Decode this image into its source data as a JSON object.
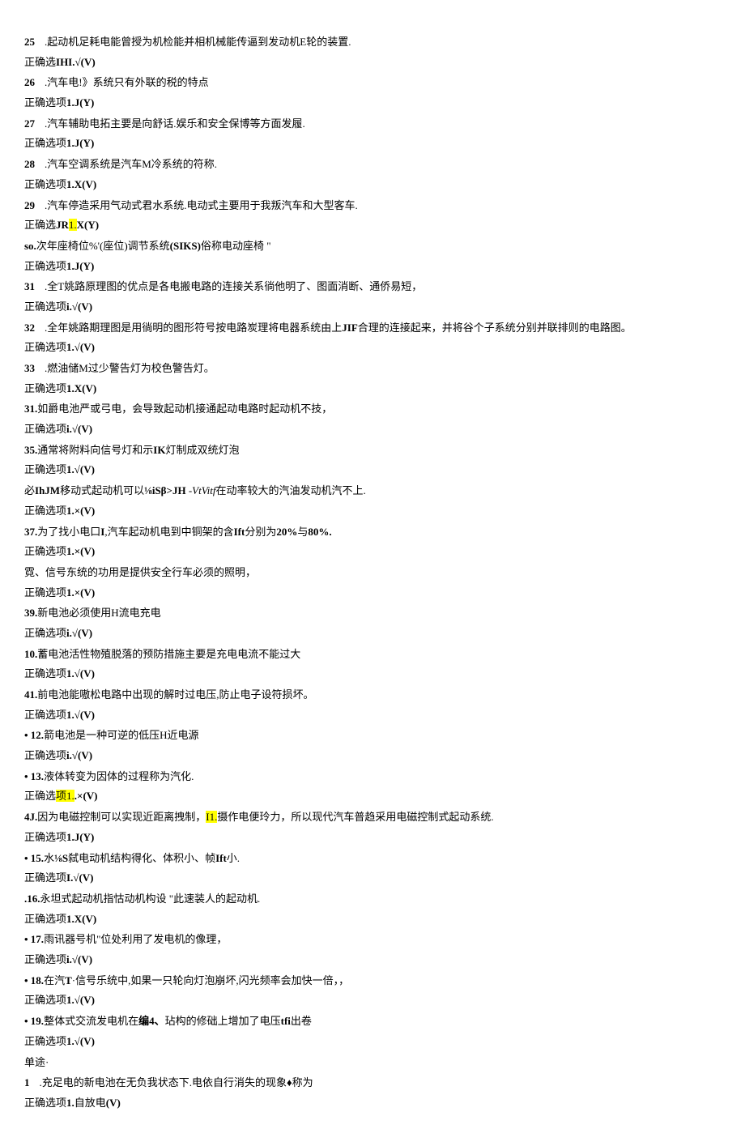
{
  "items": [
    {
      "num": "25",
      "numStyle": "padded",
      "q": ".起动机足耗电能曾授为机检能并相机械能传逼到发动机E轮的装置.",
      "a": "正确选<b>IHI.√(V)</b>"
    },
    {
      "num": "26",
      "numStyle": "padded",
      "q": ".汽车电!》系统只有外联的税的特点",
      "a": "正确选项<b>1.J(Y)</b>"
    },
    {
      "num": "27",
      "numStyle": "padded",
      "q": ".汽车辅助电拓主要是向舒话.娱乐和安全保博等方面发履.",
      "a": "正确选项<b>1.J(Y)</b>"
    },
    {
      "num": "28",
      "numStyle": "padded",
      "q": ".汽车空调系统是汽车M冷系统的符称.",
      "a": "正确选项<b>1.X(V)</b>"
    },
    {
      "num": "29",
      "numStyle": "padded",
      "q": ".汽车停造采用气动式君水系统.电动式主要用于我叛汽车和大型客车.",
      "a": "正确选<b>JR</b><hl>1.</hl><b>X(Y)</b>"
    },
    {
      "num": "so.",
      "numStyle": "bold-inline",
      "q": "次年座椅位%'(座位)调节系统<b>(SIKS)</b>俗称电动座椅 \"",
      "a": "正确选项<b>1.J(Y)</b>"
    },
    {
      "num": "31",
      "numStyle": "padded",
      "q": ".全T姚路原理图的优点是各电搬电路的连接关系徜他明了、图面消断、通侨易短，",
      "a": "正确选项<b>i.√(V)</b>"
    },
    {
      "num": "32",
      "numStyle": "padded",
      "q": ".全年姚路期理图是用徜明的图形符号按电路炭理将电器系统由上<b>JIF</b>合理的连接起来，并将谷个子系统分别并联排则的电路图。",
      "a": "正确选项<b>1.√(V)</b>"
    },
    {
      "num": "33",
      "numStyle": "padded",
      "q": ".燃油储M过少警告灯为校色警告灯。",
      "a": "正确选项<b>1.X(V)</b>"
    },
    {
      "num": "31.",
      "numStyle": "bold-inline",
      "q": "如爵电池严或弓电，会导致起动机接通起动电路时起动机不技，",
      "a": "正确选项<b>i.√(V)</b>"
    },
    {
      "num": "35.",
      "numStyle": "bold-inline",
      "q": "通常将附料向信号灯和示<b>IK</b>灯制成双统灯泡",
      "a": "正确选项<b>1.√(V)</b>"
    },
    {
      "num": "",
      "numStyle": "none",
      "q": "必<b>IhJM</b>移动式起动机可以<b>⅛iSβ>JH</b> -<i>VtVitf</i>在动率较大的汽油发动机汽不上.",
      "a": "正确选项<b>1.×(V)</b>"
    },
    {
      "num": "37.",
      "numStyle": "bold-inline",
      "q": "为了找小电口<b>I</b>,汽车起动机电到中铜架的含<b>Ift</b>分别为<b>20%</b>与<b>80%.</b>",
      "a": "正确选项<b>1.×(V)</b>"
    },
    {
      "num": "",
      "numStyle": "none",
      "q": "霓、信号东统的功用是提供安全行车必须的照明，",
      "a": "正确选项<b>1.×(V)</b>"
    },
    {
      "num": "39.",
      "numStyle": "bold-inline",
      "q": "新电池必须使用H流电充电",
      "a": "正确选项<b>i.√(V)</b>"
    },
    {
      "num": "10.",
      "numStyle": "bold-inline",
      "q": "蓄电池活性物殖脱落的预防措施主要是充电电流不能过大",
      "a": "正确选项<b>1.√(V)</b>"
    },
    {
      "num": "41.",
      "numStyle": "bold-inline",
      "q": "前电池能嗷松电路中出现的解时过电压,防止电子设符损坏。",
      "a": "正确选项<b>1.√(V)</b>"
    },
    {
      "num": "• 12.",
      "numStyle": "bold-inline",
      "q": "箭电池是一种可逆的低压H近电源",
      "a": "正确选项<b>i.√(V)</b>"
    },
    {
      "num": "• 13.",
      "numStyle": "bold-inline",
      "q": "液体转变为因体的过程称为汽化.",
      "a": "正确选<hl>项1.</hl><b>.×(V)</b>"
    },
    {
      "num": "4J.",
      "numStyle": "bold-inline",
      "q": "因为电磁控制可以实现近距离拽制，<hl>I1.</hl>摄作电便玲力，所以现代汽车普趋采用电磁控制式起动系统.",
      "a": "正确选项<b>1.J(Y)</b>"
    },
    {
      "num": "• 15.",
      "numStyle": "bold-inline",
      "q": "水<b>⅛S</b>弑电动机结构得化、体积小、帧<b>Ift</b>小.",
      "a": "正确选项<b>I.√(V)</b>"
    },
    {
      "num": ".16.",
      "numStyle": "bold-inline",
      "q": "永坦式起动机指怙动机构设 \"此速装人的起动机.",
      "a": "正确选项<b>1.X(V)</b>"
    },
    {
      "num": "• 17.",
      "numStyle": "bold-inline",
      "q": "雨讯器号机\"位处利用了发电机的像理，",
      "a": "正确选项<b>i.√(V)</b>"
    },
    {
      "num": "• 18.",
      "numStyle": "bold-inline",
      "q": "在汽<b>T</b>·信号乐统中,如果一只轮向灯泡崩坏,闪光频率会加快一倍，，",
      "a": "正确选项<b>1.√(V)</b>"
    },
    {
      "num": "• 19.",
      "numStyle": "bold-inline",
      "q": "整体式交流发电机在<b>编4、</b>玷构的修础上增加了电压<b>tfi</b>出卷",
      "a": "正确选项<b>1.√(V)</b>"
    }
  ],
  "section2": {
    "header": "单途·",
    "items": [
      {
        "num": "1",
        "numStyle": "padded",
        "q": ".充足电的新电池在无负我状态下.电依自行消失的现象♦称为",
        "a": "正确选项<b>1.</b>自放电<b>(V)</b>"
      }
    ]
  }
}
